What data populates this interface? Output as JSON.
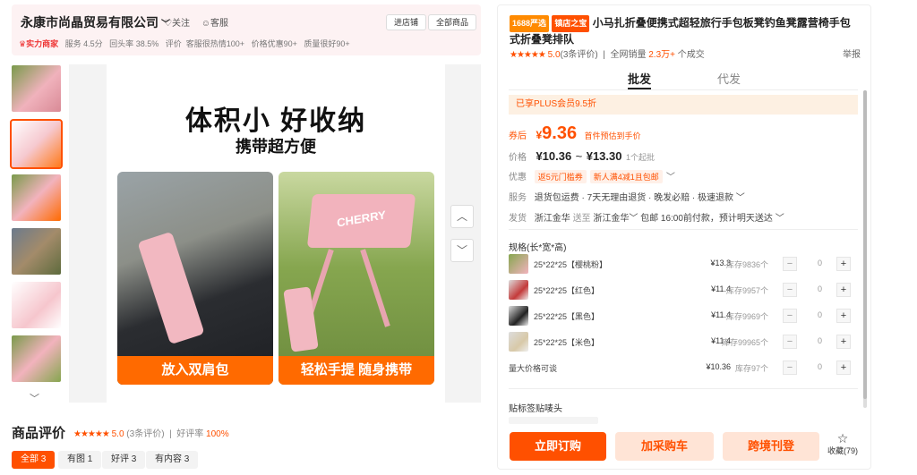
{
  "shop": {
    "name": "永康市尚晶贸易有限公司",
    "follow_label": "关注",
    "service_label": "客服",
    "enter_shop_label": "进店铺",
    "all_products_label": "全部商品",
    "strength_label": "实力商家",
    "service_score_label": "服务",
    "service_score": "4.5分",
    "repeat_rate_label": "回头率",
    "repeat_rate": "38.5%",
    "evaluation_label": "评价",
    "eval_tags": [
      "客服很热情100+",
      "价格优惠90+",
      "质量很好90+"
    ]
  },
  "gallery": {
    "hero_title": "体积小 好收纳",
    "hero_subtitle": "携带超方便",
    "caption_left": "放入双肩包",
    "caption_right": "轻松手提 随身携带",
    "stool_text": "CHERRY",
    "up_arrow": "︿",
    "down_arrow": "﹀"
  },
  "reviews": {
    "title": "商品评价",
    "stars": "★★★★★",
    "score": "5.0",
    "count_text": "(3条评价)",
    "good_rate_label": "好评率",
    "good_rate": "100%",
    "tabs": [
      "全部 3",
      "有图 1",
      "好评 3",
      "有内容 3"
    ]
  },
  "product": {
    "badge_1688": "1688严选",
    "badge_shop": "镇店之宝",
    "title": "小马扎折叠便携式超轻旅行手包板凳钓鱼凳露营椅手包式折叠凳排队",
    "stars": "★★★★★",
    "score": "5.0",
    "review_count": "(3条评价)",
    "sales_label": "全网销量",
    "sales_value": "2.3万+",
    "sales_suffix": "个成交",
    "report_label": "举报",
    "tab_wholesale": "批发",
    "tab_dropship": "代发",
    "plus_text": "已享PLUS会员9.5折",
    "after_coupon_label": "券后",
    "after_coupon_currency": "¥",
    "after_coupon_price": "9.36",
    "after_coupon_note": "首件预估到手价",
    "price_label": "价格",
    "price_range_low": "¥10.36",
    "price_range_tilde": "~",
    "price_range_high": "¥13.30",
    "min_order": "1个起批",
    "promo_label": "优惠",
    "promo_tags": [
      "返5元门槛券",
      "新人满4减1且包邮"
    ],
    "service_label": "服务",
    "service_text": "退货包运费 · 7天无理由退货 · 晚发必赔 · 极速退款",
    "ship_label": "发货",
    "ship_from": "浙江金华",
    "ship_mid": "送至",
    "ship_to": "浙江金华",
    "ship_rest": "包邮   16:00前付款，预计明天送达"
  },
  "skus": {
    "heading": "规格(长*宽*高)",
    "items": [
      {
        "name": "25*22*25【樱桃粉】",
        "price": "¥13.3",
        "stock": "库存9836个",
        "qty": "0"
      },
      {
        "name": "25*22*25【红色】",
        "price": "¥11.4",
        "stock": "库存9957个",
        "qty": "0"
      },
      {
        "name": "25*22*25【黑色】",
        "price": "¥11.4",
        "stock": "库存9969个",
        "qty": "0"
      },
      {
        "name": "25*22*25【米色】",
        "price": "¥11.4",
        "stock": "库存99965个",
        "qty": "0"
      },
      {
        "name": "量大价格可谈",
        "price": "¥10.36",
        "stock": "库存97个",
        "qty": "0"
      }
    ],
    "sticker_heading": "贴标签贴唛头"
  },
  "actions": {
    "buy_now": "立即订购",
    "add_cart": "加采购车",
    "cross_border": "跨境刊登",
    "favorite_label": "收藏",
    "favorite_count": "(79)"
  },
  "colors": {
    "accent": "#ff5000",
    "caption": "#ff6a00",
    "pink": "#f2b3bd"
  }
}
